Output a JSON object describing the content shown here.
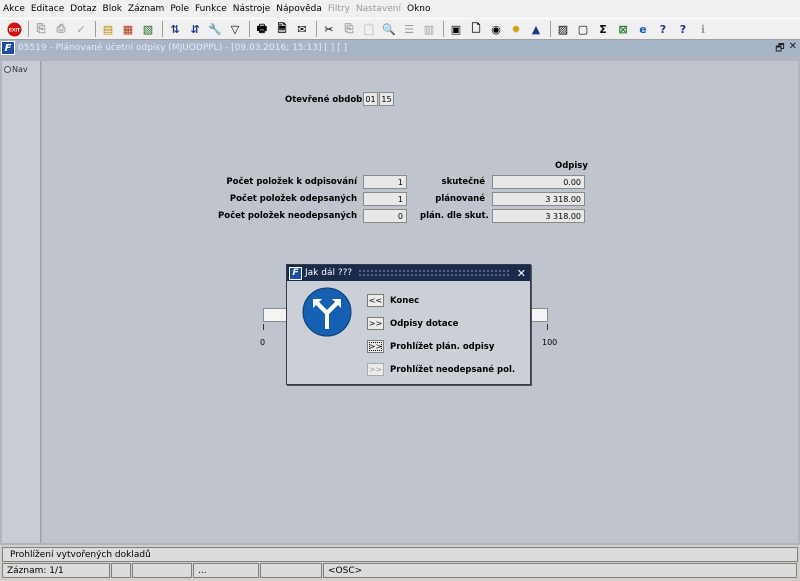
{
  "menubar": {
    "items": [
      {
        "label": "Akce",
        "enabled": true
      },
      {
        "label": "Editace",
        "enabled": true
      },
      {
        "label": "Dotaz",
        "enabled": true
      },
      {
        "label": "Blok",
        "enabled": true
      },
      {
        "label": "Záznam",
        "enabled": true
      },
      {
        "label": "Pole",
        "enabled": true
      },
      {
        "label": "Funkce",
        "enabled": true
      },
      {
        "label": "Nástroje",
        "enabled": true
      },
      {
        "label": "Nápověda",
        "enabled": true
      },
      {
        "label": "Filtry",
        "enabled": false
      },
      {
        "label": "Nastavení",
        "enabled": false
      },
      {
        "label": "Okno",
        "enabled": true
      }
    ]
  },
  "window": {
    "title": "05519 - Plánované účetní odpisy (MJUODPPL) - [09.03.2016; 15:13]  [ ]  [ ]",
    "restore_glyph": "🗗",
    "close_glyph": "✕"
  },
  "nav": {
    "label": "Nav"
  },
  "form": {
    "period_label": "Otevřené období",
    "period_month": "01",
    "period_year": "15",
    "odpisy_header": "Odpisy",
    "rows": [
      {
        "label": "Počet položek k odpisování",
        "count": "1",
        "type_label": "skutečné",
        "amount": "0.00"
      },
      {
        "label": "Počet položek odepsaných",
        "count": "1",
        "type_label": "plánované",
        "amount": "3 318.00"
      },
      {
        "label": "Počet položek neodepsaných",
        "count": "0",
        "type_label": "plán. dle skut.",
        "amount": "3 318.00"
      }
    ],
    "progress": {
      "min_label": "0",
      "max_label": "100",
      "value": 0
    }
  },
  "dialog": {
    "title": "Jak dál ???",
    "options": [
      {
        "button": "<<",
        "label": "Konec",
        "state": "normal"
      },
      {
        "button": ">>",
        "label": "Odpisy dotace",
        "state": "normal"
      },
      {
        "button": ">>",
        "label": "Prohlížet plán. odpisy",
        "state": "focused"
      },
      {
        "button": ">>",
        "label": "Prohlížet neodepsané pol.",
        "state": "disabled"
      }
    ]
  },
  "status": {
    "message": "Prohlížení vytvořených dokladů",
    "record": "Záznam: 1/1",
    "cell_dots": "...",
    "mode": "<OSC>"
  },
  "colors": {
    "content_bg": "#c0c4cc",
    "dialog_title_bg": "#1a2a4a",
    "sign_blue": "#1560b0"
  }
}
